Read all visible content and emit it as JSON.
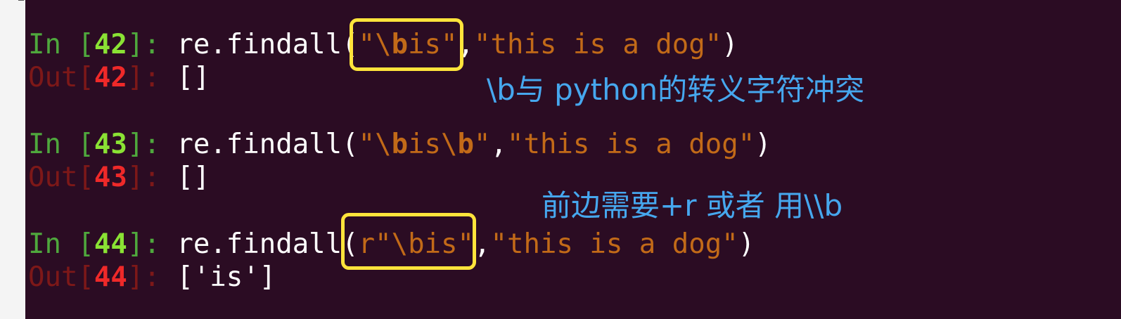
{
  "cells": [
    {
      "in_prefix": "In [",
      "in_num": "42",
      "in_suffix": "]: ",
      "code_fn": "re.findall(",
      "pattern_parts": [
        "\"\\",
        "b",
        "is\""
      ],
      "comma": ",",
      "arg": "\"this is a dog\"",
      "close": ")",
      "out_prefix": "Out[",
      "out_num": "42",
      "out_suffix": "]: ",
      "result": "[]"
    },
    {
      "in_prefix": "In [",
      "in_num": "43",
      "in_suffix": "]: ",
      "code_fn": "re.findall(",
      "pattern_parts": [
        "\"\\",
        "b",
        "is\\",
        "b",
        "\""
      ],
      "comma": ",",
      "arg": "\"this is a dog\"",
      "close": ")",
      "out_prefix": "Out[",
      "out_num": "43",
      "out_suffix": "]: ",
      "result": "[]"
    },
    {
      "in_prefix": "In [",
      "in_num": "44",
      "in_suffix": "]: ",
      "code_fn": "re.findall(",
      "pattern_parts": [
        "r\"\\bis\""
      ],
      "comma": ",",
      "arg": "\"this is a dog\"",
      "close": ")",
      "out_prefix": "Out[",
      "out_num": "44",
      "out_suffix": "]: ",
      "result": "['is']"
    }
  ],
  "annotations": {
    "note1": "\\b与 python的转义字符冲突",
    "note2": "前边需要+r 或者 用\\\\b"
  },
  "colors": {
    "background": "#2b0c23",
    "string": "#c26a18",
    "in_num": "#8ae234",
    "out_num": "#ef2929",
    "highlight_box": "#ffe43b",
    "annotation": "#46a7ee"
  }
}
